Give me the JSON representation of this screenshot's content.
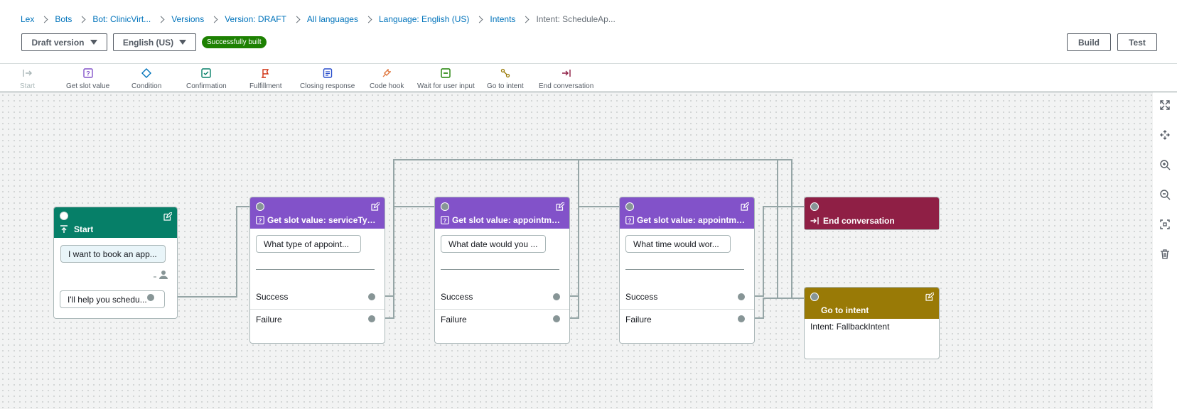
{
  "breadcrumb": [
    {
      "label": "Lex"
    },
    {
      "label": "Bots"
    },
    {
      "label": "Bot: ClinicVirt..."
    },
    {
      "label": "Versions"
    },
    {
      "label": "Version: DRAFT"
    },
    {
      "label": "All languages"
    },
    {
      "label": "Language: English (US)"
    },
    {
      "label": "Intents"
    },
    {
      "label": "Intent: ScheduleAp..."
    }
  ],
  "header": {
    "version_select": "Draft version",
    "language_select": "English (US)",
    "build_status": "Successfully built",
    "build_button": "Build",
    "test_button": "Test"
  },
  "toolbar": {
    "start": "Start",
    "get_slot_value": "Get slot value",
    "condition": "Condition",
    "confirmation": "Confirmation",
    "fulfillment": "Fulfillment",
    "closing_response": "Closing response",
    "code_hook": "Code hook",
    "wait_for_user_input": "Wait for user input",
    "go_to_intent": "Go to intent",
    "end_conversation": "End conversation"
  },
  "nodes": {
    "start": {
      "title": "Start",
      "user_utterance": "I want to book an app...",
      "bot_response": "I'll help you schedu..."
    },
    "slot1": {
      "title": "Get slot value: serviceType",
      "prompt": "What type of appoint...",
      "success": "Success",
      "failure": "Failure"
    },
    "slot2": {
      "title": "Get slot value: appointment...",
      "prompt": "What date would you ...",
      "success": "Success",
      "failure": "Failure"
    },
    "slot3": {
      "title": "Get slot value: appointment...",
      "prompt": "What time would wor...",
      "success": "Success",
      "failure": "Failure"
    },
    "end": {
      "title": "End conversation"
    },
    "goto": {
      "title": "Go to intent",
      "intent": "Intent: FallbackIntent"
    }
  },
  "colors": {
    "start_header": "#067f68",
    "slot_header": "#8252c9",
    "end_header": "#8f1f45",
    "goto_header": "#997a06",
    "connector": "#95a5a6",
    "status_green": "#1d8102",
    "link_blue": "#0073bb"
  }
}
